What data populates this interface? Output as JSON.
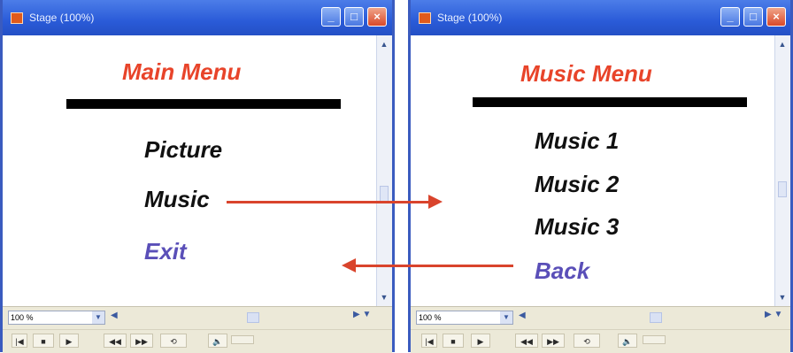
{
  "left_window": {
    "title": "Stage (100%)",
    "menu_title": "Main Menu",
    "items": [
      "Picture",
      "Music",
      "Exit"
    ],
    "zoom": "100 %"
  },
  "right_window": {
    "title": "Stage (100%)",
    "menu_title": "Music Menu",
    "items": [
      "Music 1",
      "Music 2",
      "Music 3",
      "Back"
    ],
    "zoom": "100 %"
  },
  "window_buttons": {
    "minimize": "_",
    "maximize": "□",
    "close": "×"
  },
  "controls": [
    "|◀",
    "■",
    "▶",
    "◀◀",
    "▶▶",
    "⟲",
    "🔈"
  ],
  "colors": {
    "title_red": "#e8442a",
    "link_blue": "#5a4fb8",
    "arrow_red": "#d9442c",
    "titlebar_blue": "#2a5bd8"
  }
}
